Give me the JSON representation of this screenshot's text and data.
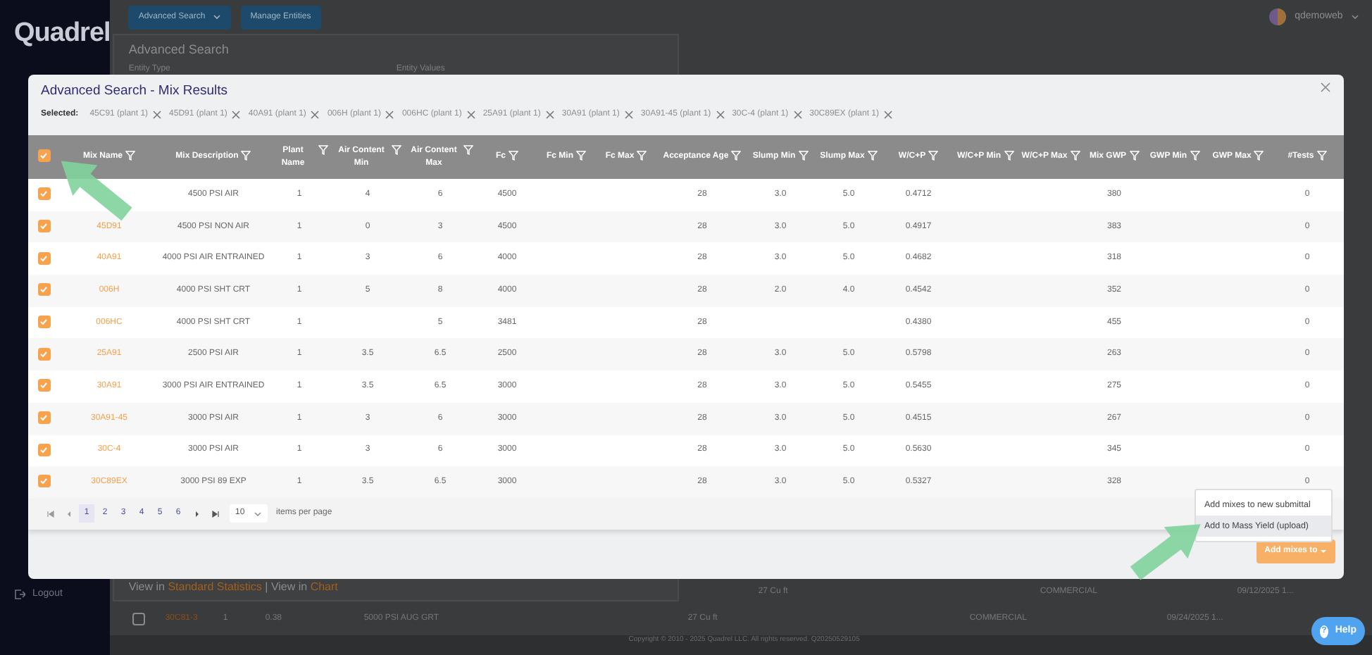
{
  "app": {
    "logo": "Quadrel",
    "top_buttons": [
      {
        "label": "Advanced Search",
        "kind": "dropdown"
      },
      {
        "label": "Manage Entities",
        "kind": "plain"
      }
    ],
    "user": "qdemoweb",
    "panel": {
      "title": "Advanced Search",
      "fields": [
        "Entity Type",
        "Entity Values"
      ],
      "links_line": [
        {
          "text": "View in",
          "kind": "text"
        },
        {
          "text": "Standard Statistics",
          "kind": "link"
        },
        {
          "text": "| View in",
          "kind": "text"
        },
        {
          "text": "Chart",
          "kind": "link"
        }
      ]
    },
    "sidebar_bottom": "Logout",
    "rows": [
      {
        "cells": [
          "",
          "",
          "",
          "",
          "27 Cu ft",
          "COMMERCIAL",
          "09/12/2025 1..."
        ]
      },
      {
        "checkbox": false,
        "cells": [
          "30C81-3",
          "1",
          "0.38",
          "5000 PSI AUG GRT",
          "27 Cu ft",
          "COMMERCIAL",
          "09/24/2025 1..."
        ]
      }
    ],
    "footer": "Copyright © 2010 - 2025 Quadrel LLC. All rights reserved. Q20250529105",
    "help": {
      "glyph": "?",
      "label": "Help"
    }
  },
  "modal": {
    "title": "Advanced Search - Mix Results",
    "selected_label": "Selected:",
    "selected": [
      "45C91 (plant 1)",
      "45D91 (plant 1)",
      "40A91 (plant 1)",
      "006H (plant 1)",
      "006HC (plant 1)",
      "25A91 (plant 1)",
      "30A91 (plant 1)",
      "30A91-45 (plant 1)",
      "30C-4 (plant 1)",
      "30C89EX (plant 1)"
    ],
    "table": {
      "all_checked": true,
      "columns": [
        "Mix Name",
        "Mix Description",
        "Plant Name",
        "Air Content Min",
        "Air Content Max",
        "Fc",
        "Fc Min",
        "Fc Max",
        "Acceptance Age",
        "Slump Min",
        "Slump Max",
        "W/C+P",
        "W/C+P Min",
        "W/C+P Max",
        "Mix GWP",
        "GWP Min",
        "GWP Max",
        "#Tests"
      ],
      "rows": [
        {
          "checked": true,
          "cells": [
            "",
            "4500 PSI AIR",
            "1",
            "4",
            "6",
            "4500",
            "",
            "",
            "28",
            "3.0",
            "5.0",
            "0.4712",
            "",
            "",
            "380",
            "",
            "",
            "0"
          ]
        },
        {
          "checked": true,
          "cells": [
            "45D91",
            "4500 PSI NON AIR",
            "1",
            "0",
            "3",
            "4500",
            "",
            "",
            "28",
            "3.0",
            "5.0",
            "0.4917",
            "",
            "",
            "383",
            "",
            "",
            "0"
          ]
        },
        {
          "checked": true,
          "cells": [
            "40A91",
            "4000 PSI AIR ENTRAINED",
            "1",
            "3",
            "6",
            "4000",
            "",
            "",
            "28",
            "3.0",
            "5.0",
            "0.4682",
            "",
            "",
            "318",
            "",
            "",
            "0"
          ]
        },
        {
          "checked": true,
          "cells": [
            "006H",
            "4000 PSI SHT CRT",
            "1",
            "5",
            "8",
            "4000",
            "",
            "",
            "28",
            "2.0",
            "4.0",
            "0.4542",
            "",
            "",
            "352",
            "",
            "",
            "0"
          ]
        },
        {
          "checked": true,
          "cells": [
            "006HC",
            "4000 PSI SHT CRT",
            "1",
            "",
            "5",
            "3481",
            "",
            "",
            "28",
            "",
            "",
            "0.4380",
            "",
            "",
            "455",
            "",
            "",
            "0"
          ]
        },
        {
          "checked": true,
          "cells": [
            "25A91",
            "2500 PSI AIR",
            "1",
            "3.5",
            "6.5",
            "2500",
            "",
            "",
            "28",
            "3.0",
            "5.0",
            "0.5798",
            "",
            "",
            "263",
            "",
            "",
            "0"
          ]
        },
        {
          "checked": true,
          "cells": [
            "30A91",
            "3000 PSI AIR ENTRAINED",
            "1",
            "3.5",
            "6.5",
            "3000",
            "",
            "",
            "28",
            "3.0",
            "5.0",
            "0.5455",
            "",
            "",
            "275",
            "",
            "",
            "0"
          ]
        },
        {
          "checked": true,
          "cells": [
            "30A91-45",
            "3000 PSI AIR",
            "1",
            "3",
            "6",
            "3000",
            "",
            "",
            "28",
            "3.0",
            "5.0",
            "0.4515",
            "",
            "",
            "267",
            "",
            "",
            "0"
          ]
        },
        {
          "checked": true,
          "cells": [
            "30C-4",
            "3000 PSI AIR",
            "1",
            "3",
            "6",
            "3000",
            "",
            "",
            "28",
            "3.0",
            "5.0",
            "0.5630",
            "",
            "",
            "345",
            "",
            "",
            "0"
          ]
        },
        {
          "checked": true,
          "cells": [
            "30C89EX",
            "3000 PSI 89 EXP",
            "1",
            "3.5",
            "6.5",
            "3000",
            "",
            "",
            "28",
            "3.0",
            "5.0",
            "0.5327",
            "",
            "",
            "328",
            "",
            "",
            "0"
          ]
        }
      ]
    },
    "pagination": {
      "pages": [
        {
          "label": "1",
          "selected": true
        },
        {
          "label": "2",
          "selected": false
        },
        {
          "label": "3",
          "selected": false
        },
        {
          "label": "4",
          "selected": false
        },
        {
          "label": "5",
          "selected": false
        },
        {
          "label": "6",
          "selected": false
        }
      ],
      "page_size": "10",
      "page_size_label": "items per page"
    },
    "menu": [
      {
        "label": "Add mixes to new submittal",
        "highlighted": false
      },
      {
        "label": "Add to Mass Yield (upload)",
        "highlighted": true
      }
    ],
    "action_button": "Add mixes to"
  }
}
